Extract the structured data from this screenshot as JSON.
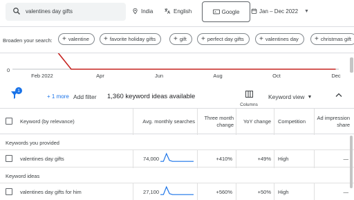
{
  "search": {
    "value": "valentines day gifts"
  },
  "location": "India",
  "language": "English",
  "network": "Google",
  "date_range": "Jan – Dec 2022",
  "broaden": {
    "label": "Broaden your search:",
    "chips": [
      "valentine",
      "favorite holiday gifts",
      "gift",
      "perfect day gifts",
      "valentines day",
      "christmas gift"
    ]
  },
  "chart_data": {
    "type": "line",
    "x": [
      "Jan 2022",
      "Feb 2022",
      "Mar 2022",
      "Apr 2022",
      "May 2022",
      "Jun 2022",
      "Jul 2022",
      "Aug 2022",
      "Sep 2022",
      "Oct 2022",
      "Nov 2022",
      "Dec 2022"
    ],
    "tick_labels": [
      "Feb 2022",
      "Apr",
      "Jun",
      "Aug",
      "Oct",
      "Dec"
    ],
    "y_tick_label": "0",
    "series": [
      {
        "color": "#c5221f",
        "values": [
          300000,
          300000,
          0,
          0,
          0,
          0,
          0,
          0,
          0,
          0,
          0,
          0
        ]
      }
    ]
  },
  "toolbar": {
    "badge": "1",
    "more": "+ 1 more",
    "add_filter": "Add filter",
    "count": "1,360 keyword ideas available",
    "columns": "Columns",
    "view": "Keyword view"
  },
  "table": {
    "headers": {
      "keyword": "Keyword (by relevance)",
      "searches": "Avg. monthly searches",
      "three_month": "Three month change",
      "yoy": "YoY change",
      "competition": "Competition",
      "impression": "Ad impression share"
    },
    "groups": [
      {
        "label": "Keywords you provided",
        "rows": [
          {
            "keyword": "valentines day gifts",
            "searches": "74,000",
            "three_month": "+410%",
            "yoy": "+49%",
            "competition": "High",
            "impression": "—",
            "spark": [
              2,
              2,
              10,
              3,
              2,
              2,
              2,
              2,
              2,
              2,
              2,
              2
            ]
          }
        ]
      },
      {
        "label": "Keyword ideas",
        "rows": [
          {
            "keyword": "valentines day gifts for him",
            "searches": "27,100",
            "three_month": "+560%",
            "yoy": "+50%",
            "competition": "High",
            "impression": "—",
            "spark": [
              2,
              2,
              10,
              3,
              2,
              2,
              2,
              2,
              2,
              2,
              2,
              2
            ]
          }
        ]
      }
    ]
  },
  "colors": {
    "accent": "#1a73e8",
    "chart_line": "#c5221f",
    "spark": "#1a73e8"
  }
}
